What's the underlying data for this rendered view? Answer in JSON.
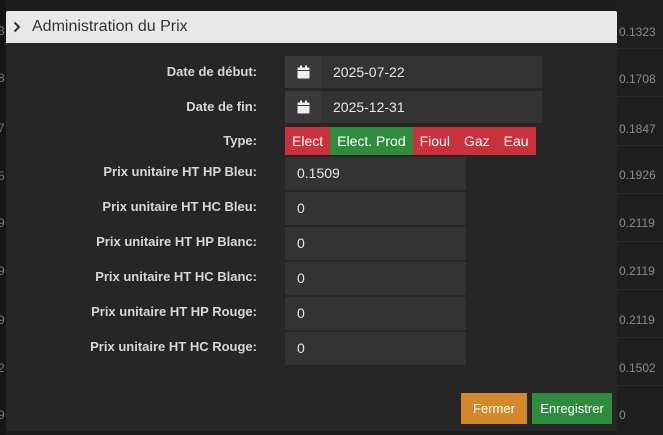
{
  "background": {
    "left_fragments": [
      "3",
      "8",
      "7",
      "5",
      "9",
      "9",
      "9",
      "2",
      "9"
    ],
    "right_values": [
      "0.1323",
      "0.1708",
      "0.1847",
      "0.1926",
      "0.2119",
      "0.2119",
      "0.2119",
      "0.1502",
      "0"
    ]
  },
  "modal": {
    "title": "Administration du Prix",
    "fields": {
      "date_debut": {
        "label": "Date de début:",
        "value": "2025-07-22",
        "icon": "calendar-icon"
      },
      "date_fin": {
        "label": "Date de fin:",
        "value": "2025-12-31",
        "icon": "calendar-icon"
      },
      "type": {
        "label": "Type:",
        "options": [
          {
            "label": "Elect",
            "color": "#c9323c"
          },
          {
            "label": "Elect. Prod",
            "color": "#2f8c3f"
          },
          {
            "label": "Fioul",
            "color": "#c9323c"
          },
          {
            "label": "Gaz",
            "color": "#c9323c"
          },
          {
            "label": "Eau",
            "color": "#c9323c"
          }
        ],
        "selected": "Elect. Prod"
      },
      "prices": [
        {
          "label": "Prix unitaire HT HP Bleu:",
          "value": "0.1509"
        },
        {
          "label": "Prix unitaire HT HC Bleu:",
          "value": "0"
        },
        {
          "label": "Prix unitaire HT HP Blanc:",
          "value": "0"
        },
        {
          "label": "Prix unitaire HT HC Blanc:",
          "value": "0"
        },
        {
          "label": "Prix unitaire HT HP Rouge:",
          "value": "0"
        },
        {
          "label": "Prix unitaire HT HC Rouge:",
          "value": "0"
        }
      ]
    },
    "buttons": {
      "close_label": "Fermer",
      "save_label": "Enregistrer"
    },
    "colors": {
      "header_bg": "#e8e8e8",
      "body_bg": "#262626",
      "close_button": "#d4882a",
      "save_button": "#2f8c3f",
      "inactive_type": "#c9323c",
      "active_type": "#2f8c3f"
    }
  }
}
